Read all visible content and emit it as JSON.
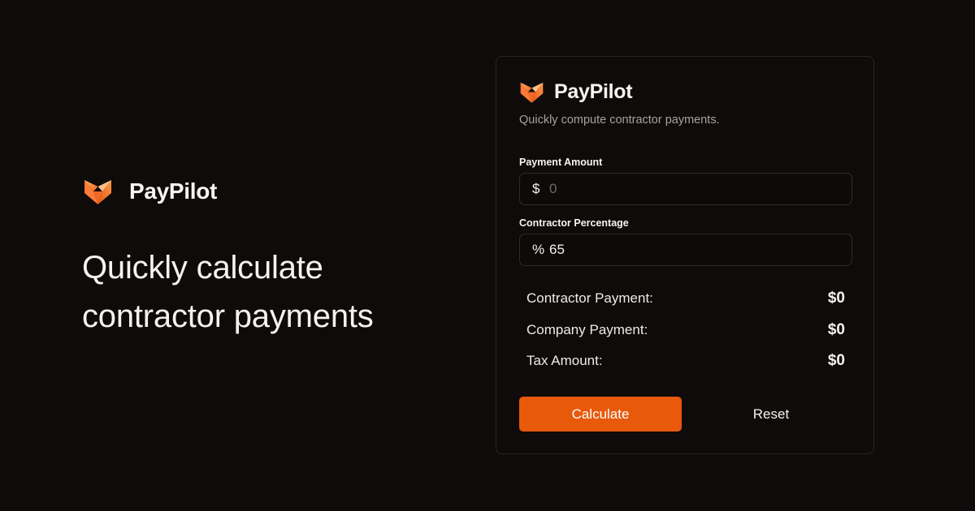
{
  "brand": {
    "name": "PayPilot",
    "accent_color": "#e8590c",
    "logo_icon": "fox-fold-logo-icon"
  },
  "hero": {
    "headline_line1": "Quickly calculate",
    "headline_line2": "contractor payments"
  },
  "calculator": {
    "title": "PayPilot",
    "subtitle": "Quickly compute contractor payments.",
    "payment_amount": {
      "label": "Payment Amount",
      "prefix": "$",
      "value": "",
      "placeholder": "0"
    },
    "contractor_percentage": {
      "label": "Contractor Percentage",
      "prefix": "%",
      "value": "65",
      "placeholder": ""
    },
    "results": [
      {
        "label": "Contractor Payment:",
        "value": "$0"
      },
      {
        "label": "Company Payment:",
        "value": "$0"
      },
      {
        "label": "Tax Amount:",
        "value": "$0"
      }
    ],
    "calculate_label": "Calculate",
    "reset_label": "Reset"
  }
}
